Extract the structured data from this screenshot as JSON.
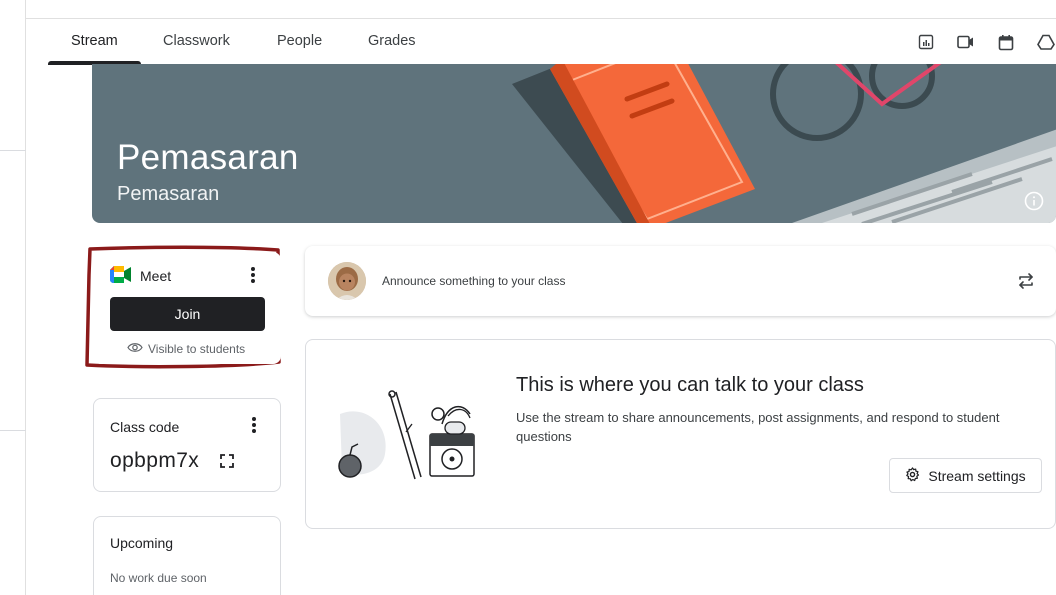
{
  "tabs": [
    {
      "label": "Stream",
      "active": true
    },
    {
      "label": "Classwork",
      "active": false
    },
    {
      "label": "People",
      "active": false
    },
    {
      "label": "Grades",
      "active": false
    }
  ],
  "toolbar_icons": [
    "gradebook-icon",
    "video-camera-icon",
    "calendar-icon",
    "drive-icon"
  ],
  "banner": {
    "title": "Pemasaran",
    "subtitle": "Pemasaran",
    "background_color": "#5f737c"
  },
  "meet": {
    "title": "Meet",
    "join_label": "Join",
    "visibility_label": "Visible to students"
  },
  "class_code": {
    "label": "Class code",
    "value": "opbpm7x"
  },
  "upcoming": {
    "label": "Upcoming",
    "empty_text": "No work due soon"
  },
  "announce": {
    "placeholder": "Announce something to your class"
  },
  "empty_stream": {
    "title": "This is where you can talk to your class",
    "description": "Use the stream to share announcements, post assignments, and respond to student questions",
    "settings_label": "Stream settings"
  },
  "colors": {
    "annotation_outline": "#8b1a1a",
    "dark_button": "#202124",
    "banner_book": "#f4683a"
  }
}
